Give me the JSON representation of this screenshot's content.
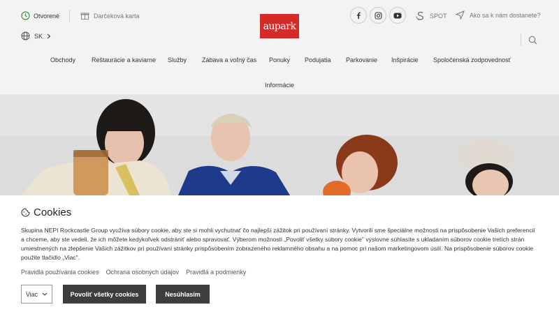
{
  "header": {
    "status": "Otvorené",
    "gift_card": "Darčeková karta",
    "language": "SK",
    "logo_text": "aupark",
    "spot_label": "SPOT",
    "directions": "Ako sa k nám dostanete?",
    "social_icons": [
      "facebook-icon",
      "instagram-icon",
      "youtube-icon"
    ]
  },
  "nav": {
    "items": [
      "Obchody",
      "Reštaurácie a kaviarne",
      "Služby",
      "Zábava a voľný čas",
      "Ponuky",
      "Podujatia",
      "Parkovanie",
      "Inšpirácie",
      "Spoločenská zodpovednosť",
      "Informácie"
    ]
  },
  "cookie": {
    "title": "Cookies",
    "text": "Skupina NEPI Rockcastle Group využíva súbory cookie, aby ste si mohli vychutnať čo najlepší zážitok pri používaní stránky. Vytvorili sme špeciálne možnosti na prispôsobenie Vašich preferencií a chceme, aby ste vedeli, že ich môžete kedykoľvek odstrániť alebo spravovať. Výberom možnosti „Povoliť všetky súbory cookie\" výslovne súhlasíte s ukladaním súborov cookie tretích strán umiestnených na zlepšenie Vašich zážitkov pri používaní stránky prispôsobením zobrazeného reklamného obsahu a na pomoc pri našom marketingovom úsilí. Na prispôsobenie súborov cookie použite tlačidlo „Viac\".",
    "links": [
      "Pravidlá používania cookies",
      "Ochrana osobných údajov",
      "Pravidlá a podmienky"
    ],
    "more_button": "Viac",
    "accept_button": "Povoliť všetky cookies",
    "decline_button": "Nesúhlasím"
  },
  "colors": {
    "brand_red": "#d42a2a",
    "status_green": "#2e9a3a",
    "dark_button": "#3d3d3d"
  }
}
